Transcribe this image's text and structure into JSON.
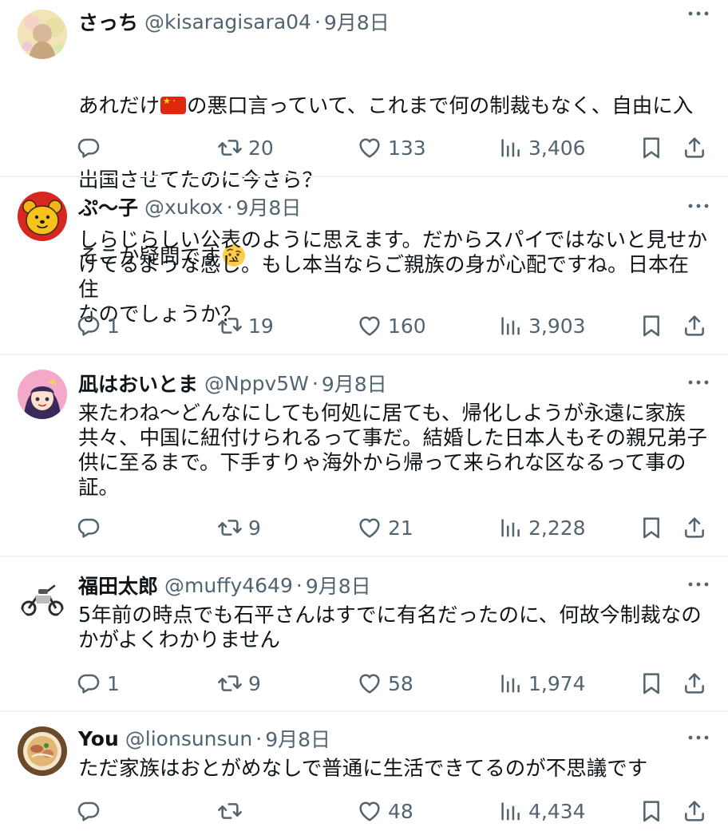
{
  "replies": [
    {
      "name": "さっち",
      "handle": "@kisaragisara04",
      "sep": "·",
      "date": "9月8日",
      "line1a": "あれだけ",
      "line1b": "の悪口言っていて、これまで何の制裁もなく、自由に入",
      "line2": "出国させてたのに今さら？",
      "line3": "そこか疑問です",
      "reply_count": "",
      "retweets": "20",
      "likes": "133",
      "views": "3,406"
    },
    {
      "name": "ぷ〜子",
      "handle": "@xukox",
      "sep": "·",
      "date": "9月8日",
      "text": "しらじらしい公表のように思えます。だからスパイではないと見せか\nけてるような感じ。もし本当ならご親族の身が心配ですね。日本在住\nなのでしょうか？",
      "reply_count": "1",
      "retweets": "19",
      "likes": "160",
      "views": "3,903"
    },
    {
      "name": "凪はおいとま",
      "handle": "@Nppv5W",
      "sep": "·",
      "date": "9月8日",
      "text": "来たわね〜どんなにしても何処に居ても、帰化しようが永遠に家族\n共々、中国に紐付けられるって事だ。結婚した日本人もその親兄弟子\n供に至るまで。下手すりゃ海外から帰って来られな区なるって事の\n証。",
      "reply_count": "",
      "retweets": "9",
      "likes": "21",
      "views": "2,228"
    },
    {
      "name": "福田太郎",
      "handle": "@muffy4649",
      "sep": "·",
      "date": "9月8日",
      "text": "5年前の時点でも石平さんはすでに有名だったのに、何故今制裁なの\nかがよくわかりません",
      "reply_count": "1",
      "retweets": "9",
      "likes": "58",
      "views": "1,974"
    },
    {
      "name": "You",
      "handle": "@lionsunsun",
      "sep": "·",
      "date": "9月8日",
      "text": "ただ家族はおとがめなしで普通に生活できてるのが不思議です",
      "reply_count": "",
      "retweets": "",
      "likes": "48",
      "views": "4,434"
    }
  ],
  "icons": {
    "more": "more-icon",
    "reply": "reply-icon",
    "retweet": "retweet-icon",
    "like": "heart-icon",
    "views": "views-icon",
    "bookmark": "bookmark-icon",
    "share": "share-icon",
    "flag": "china-flag-emoji",
    "emoji": "face-with-raised-eyebrow-emoji"
  },
  "colors": {
    "text": "#0f1419",
    "secondary": "#536471",
    "divider": "#eff3f4"
  }
}
